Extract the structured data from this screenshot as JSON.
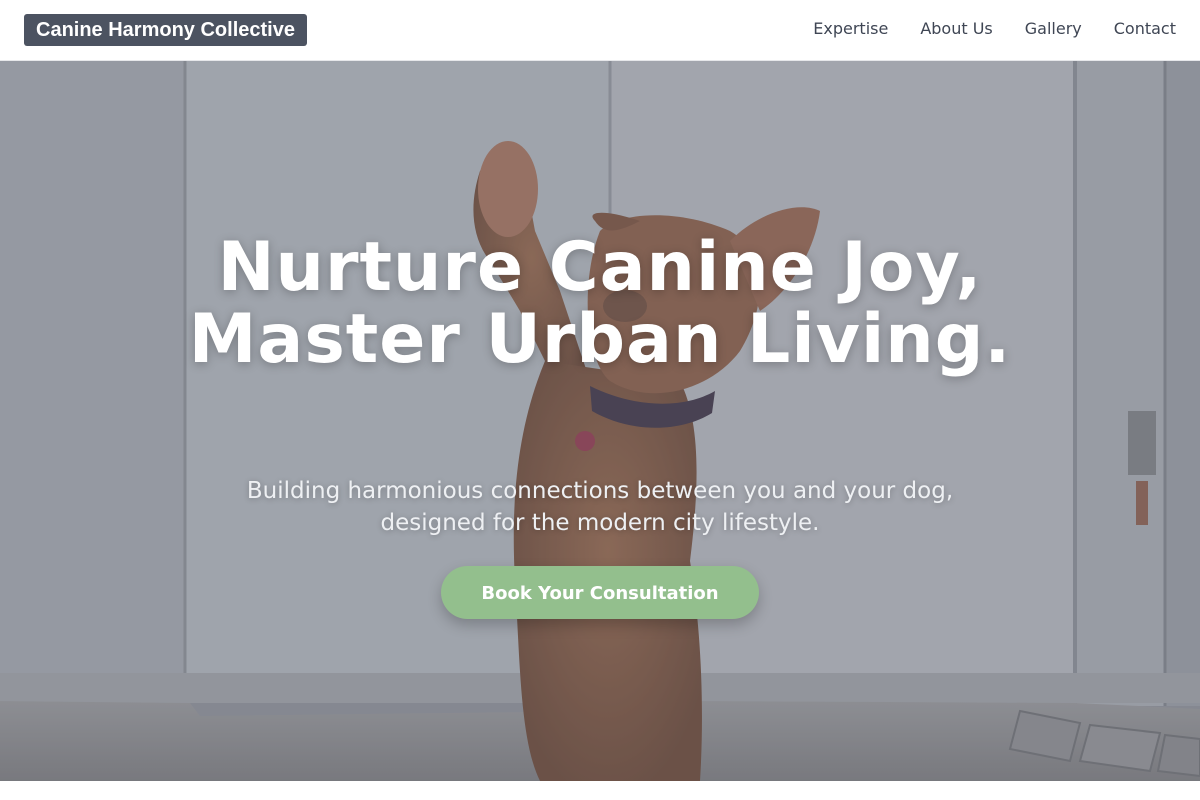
{
  "header": {
    "brand": "Canine Harmony Collective",
    "nav": [
      {
        "label": "Expertise"
      },
      {
        "label": "About Us"
      },
      {
        "label": "Gallery"
      },
      {
        "label": "Contact"
      }
    ]
  },
  "hero": {
    "title": "Nurture Canine Joy, Master Urban Living.",
    "subtitle": "Building harmonious connections between you and your dog, designed for the modern city lifestyle.",
    "cta_label": "Book Your Consultation",
    "image_subject": "dog-raising-paw-photo"
  },
  "colors": {
    "brand_bg": "#4c5361",
    "nav_text": "#3f4654",
    "cta_bg": "#93bf8d",
    "hero_text": "#ffffff"
  }
}
